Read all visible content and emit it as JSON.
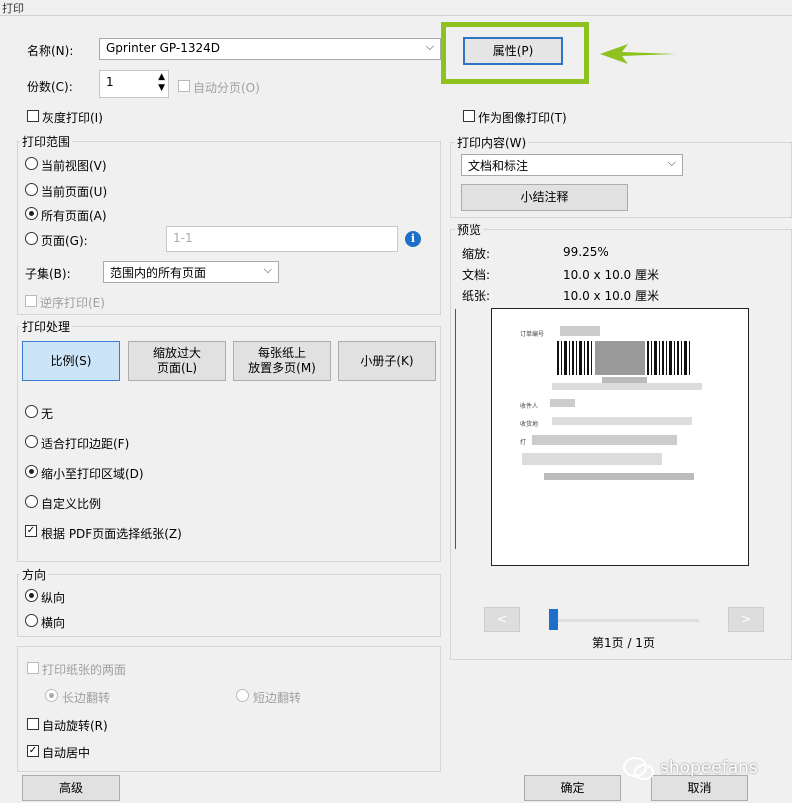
{
  "window": {
    "title": "打印"
  },
  "printer": {
    "name_label": "名称(N):",
    "name_value": "Gprinter GP-1324D",
    "properties_button": "属性(P)",
    "copies_label": "份数(C):",
    "copies_value": "1",
    "collate_label": "自动分页(O)",
    "grayscale_label": "灰度打印(I)",
    "as_image_label": "作为图像打印(T)"
  },
  "print_range": {
    "title": "打印范围",
    "options": [
      "当前视图(V)",
      "当前页面(U)",
      "所有页面(A)",
      "页面(G):"
    ],
    "selected": "所有页面(A)",
    "pages_placeholder": "1-1",
    "subset_label": "子集(B):",
    "subset_value": "范围内的所有页面",
    "reverse_label": "逆序打印(E)"
  },
  "handling": {
    "title": "打印处理",
    "buttons": [
      "比例(S)",
      "缩放过大\n页面(L)",
      "每张纸上\n放置多页(M)",
      "小册子(K)"
    ],
    "selected_button": "比例(S)",
    "options": [
      "无",
      "适合打印边距(F)",
      "缩小至打印区域(D)",
      "自定义比例"
    ],
    "selected_option": "缩小至打印区域(D)",
    "pdf_paper_label": "根据 PDF页面选择纸张(Z)",
    "pdf_paper_checked": true
  },
  "orientation": {
    "title": "方向",
    "options": [
      "纵向",
      "横向"
    ],
    "selected": "纵向"
  },
  "duplex": {
    "both_sides_label": "打印纸张的两面",
    "long_edge": "长边翻转",
    "short_edge": "短边翻转",
    "auto_rotate": "自动旋转(R)",
    "auto_center": "自动居中",
    "auto_center_checked": true
  },
  "content": {
    "title": "打印内容(W)",
    "value": "文档和标注",
    "summarize_button": "小结注释"
  },
  "preview": {
    "title": "预览",
    "zoom_label": "缩放:",
    "zoom_value": "99.25%",
    "doc_label": "文档:",
    "doc_value": "10.0 x 10.0 厘米",
    "paper_label": "纸张:",
    "paper_value": "10.0 x 10.0 厘米",
    "label_fields": [
      "订单编号",
      "收件人",
      "收货地",
      "打"
    ],
    "page_text": "第1页 / 1页",
    "prev": "<",
    "next": ">"
  },
  "footer": {
    "advanced": "高级",
    "ok": "确定",
    "cancel": "取消"
  },
  "watermark": "shopeefans",
  "colors": {
    "highlight": "#8dc21f",
    "selected_blue": "#cce4f7",
    "info_blue": "#1e6fc7"
  }
}
